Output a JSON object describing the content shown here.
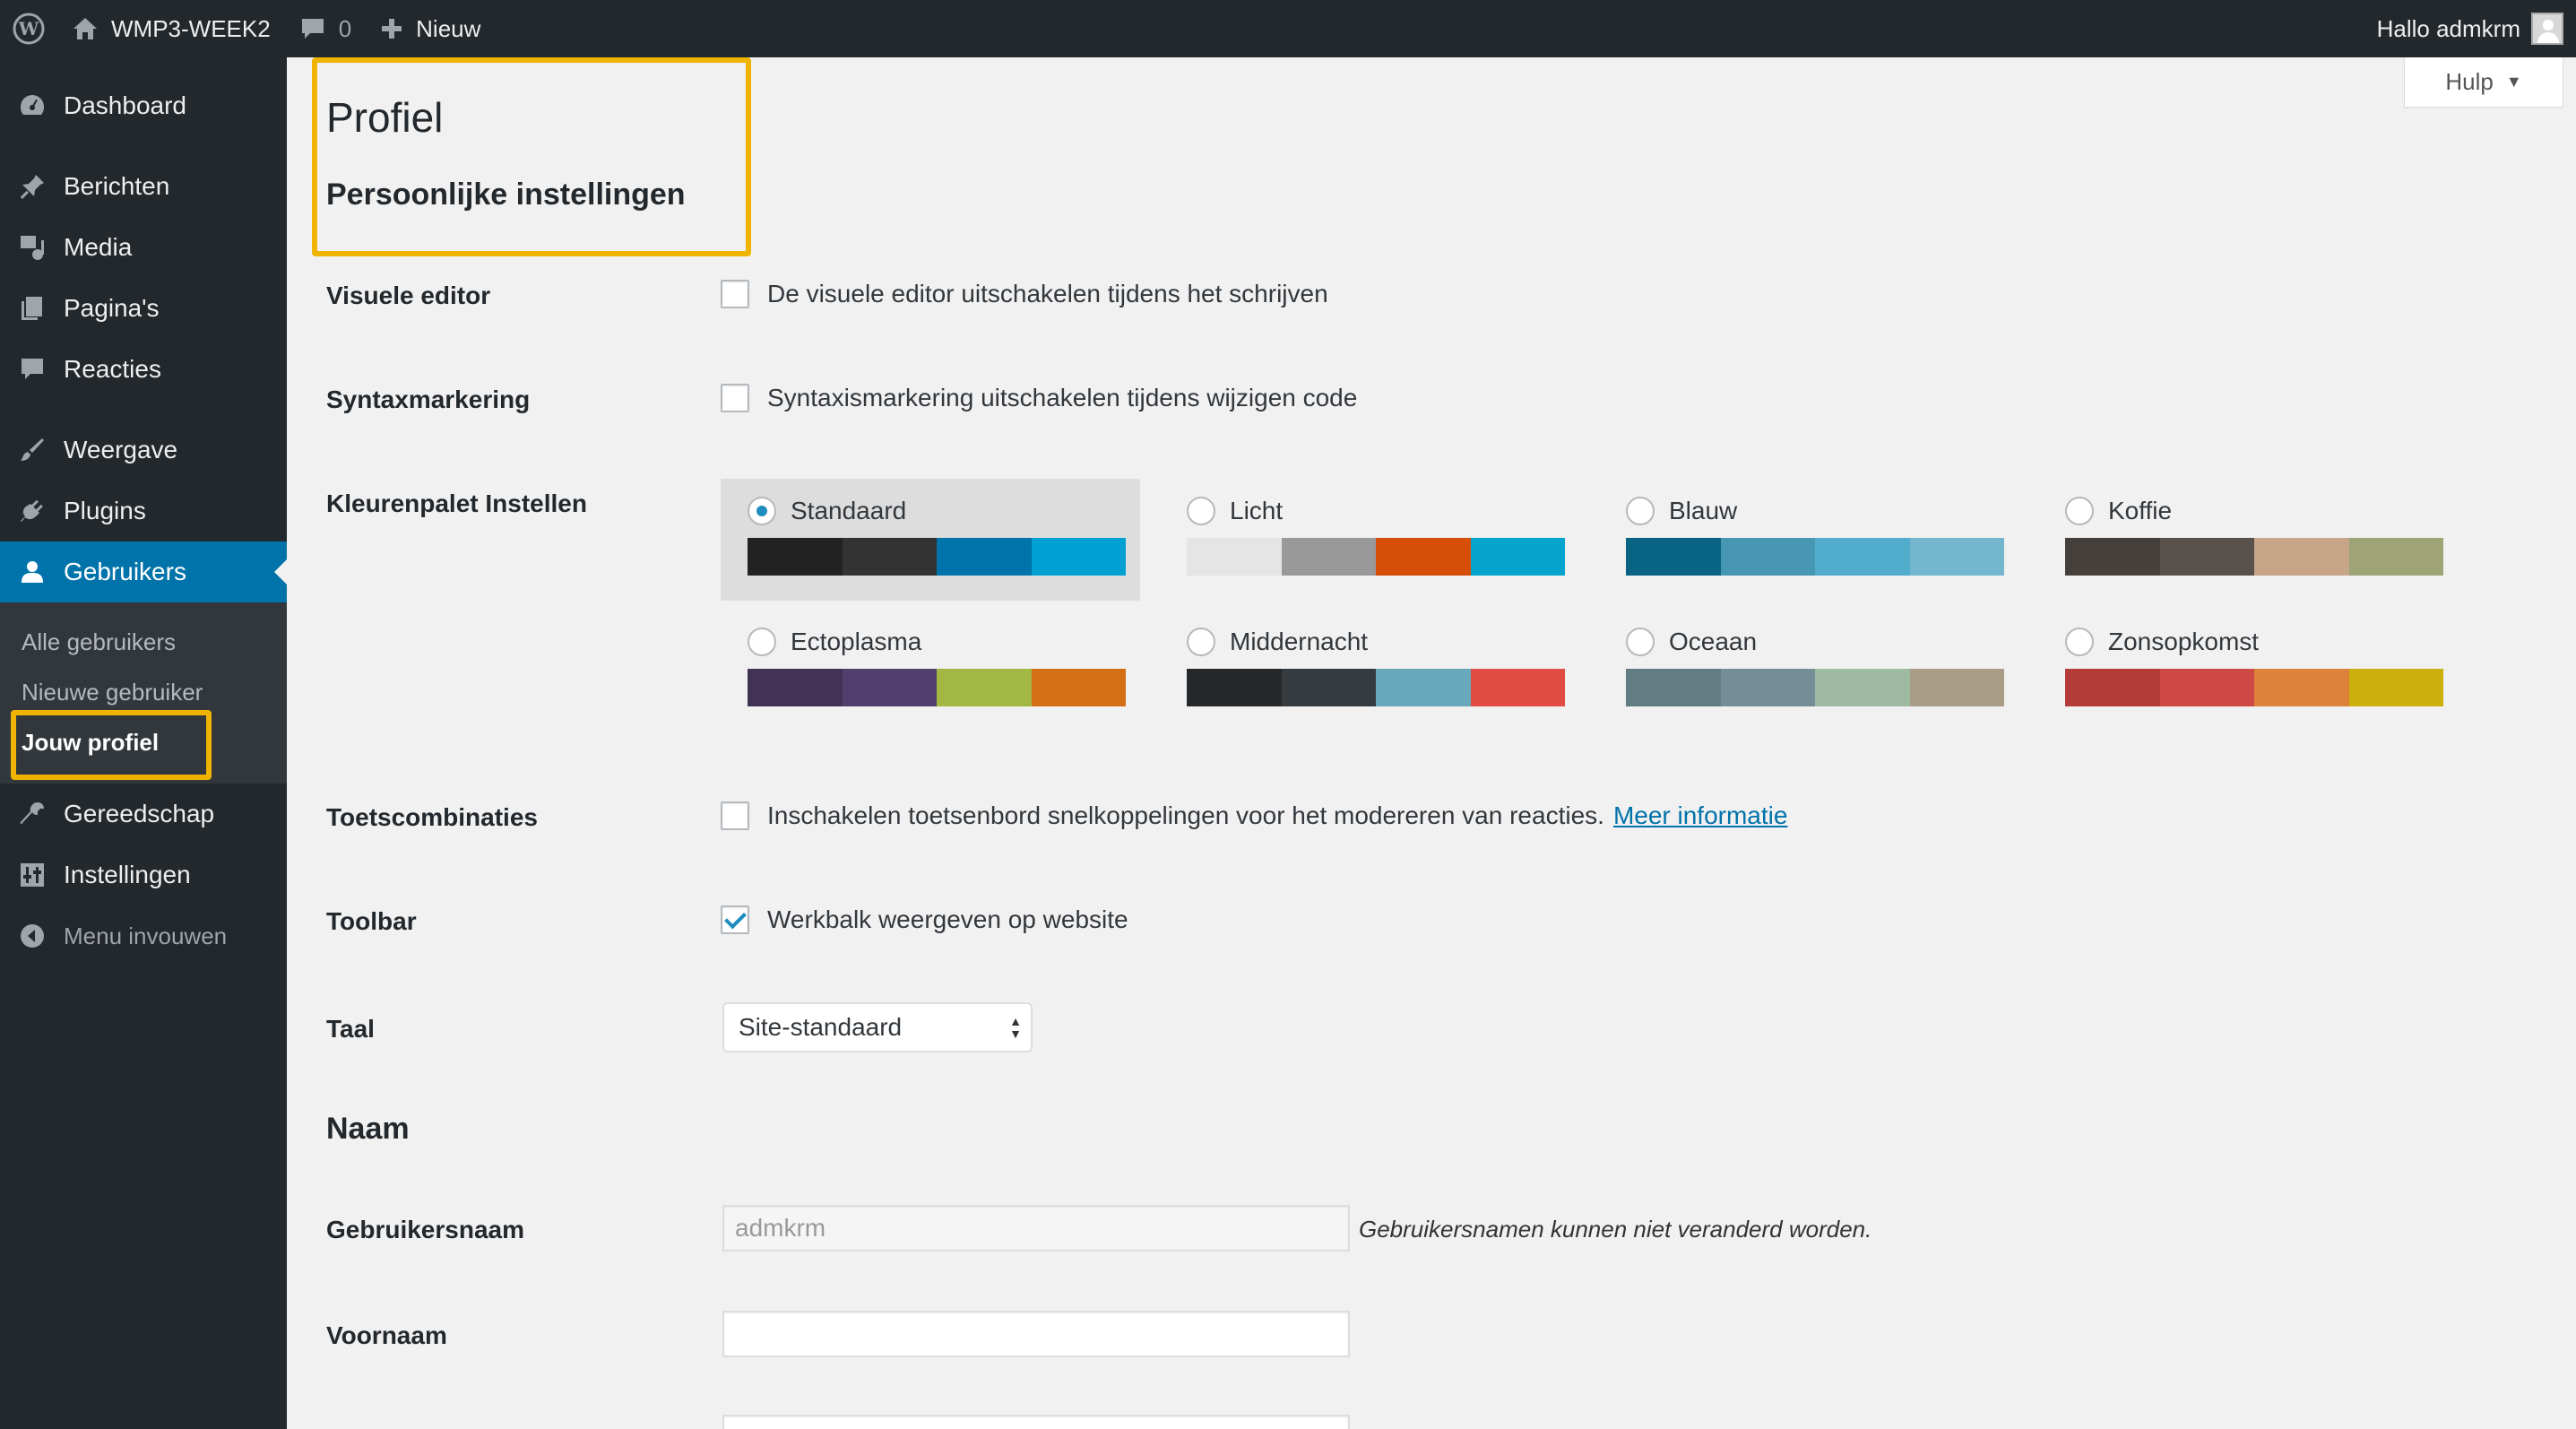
{
  "adminbar": {
    "site_name": "WMP3-WEEK2",
    "comments_count": "0",
    "new_label": "Nieuw",
    "greeting": "Hallo admkrm"
  },
  "sidebar": {
    "items": [
      {
        "label": "Dashboard",
        "icon": "dashboard-icon"
      },
      {
        "label": "Berichten",
        "icon": "pin-icon"
      },
      {
        "label": "Media",
        "icon": "media-icon"
      },
      {
        "label": "Pagina's",
        "icon": "pages-icon"
      },
      {
        "label": "Reacties",
        "icon": "comments-icon"
      },
      {
        "label": "Weergave",
        "icon": "brush-icon"
      },
      {
        "label": "Plugins",
        "icon": "plugin-icon"
      },
      {
        "label": "Gebruikers",
        "icon": "users-icon"
      },
      {
        "label": "Gereedschap",
        "icon": "wrench-icon"
      },
      {
        "label": "Instellingen",
        "icon": "settings-icon"
      }
    ],
    "submenu": [
      "Alle gebruikers",
      "Nieuwe gebruiker",
      "Jouw profiel"
    ],
    "collapse_label": "Menu invouwen"
  },
  "header": {
    "help_label": "Hulp",
    "page_title": "Profiel",
    "section_personal": "Persoonlijke instellingen"
  },
  "settings": {
    "visual_editor": {
      "label": "Visuele editor",
      "option": "De visuele editor uitschakelen tijdens het schrijven",
      "checked": false
    },
    "syntax": {
      "label": "Syntaxmarkering",
      "option": "Syntaxismarkering uitschakelen tijdens wijzigen code",
      "checked": false
    },
    "color_scheme_label": "Kleurenpalet Instellen",
    "color_schemes": [
      {
        "name": "Standaard",
        "selected": true,
        "colors": [
          "#222222",
          "#333333",
          "#0073aa",
          "#00a0d2"
        ]
      },
      {
        "name": "Licht",
        "selected": false,
        "colors": [
          "#e5e5e5",
          "#999999",
          "#d64e07",
          "#04a4cc"
        ]
      },
      {
        "name": "Blauw",
        "selected": false,
        "colors": [
          "#096484",
          "#4796b3",
          "#52accc",
          "#74b6ce"
        ]
      },
      {
        "name": "Koffie",
        "selected": false,
        "colors": [
          "#46403c",
          "#59524c",
          "#c7a589",
          "#9ea476"
        ]
      },
      {
        "name": "Ectoplasma",
        "selected": false,
        "colors": [
          "#413256",
          "#523f6d",
          "#a3b745",
          "#d46f15"
        ]
      },
      {
        "name": "Middernacht",
        "selected": false,
        "colors": [
          "#25282b",
          "#363b3f",
          "#69a8bb",
          "#e14d43"
        ]
      },
      {
        "name": "Oceaan",
        "selected": false,
        "colors": [
          "#627c83",
          "#738e96",
          "#9ebaa0",
          "#aa9d88"
        ]
      },
      {
        "name": "Zonsopkomst",
        "selected": false,
        "colors": [
          "#b43c38",
          "#cf4944",
          "#dd823b",
          "#ccaf0b"
        ]
      }
    ],
    "shortcuts": {
      "label": "Toetscombinaties",
      "option": "Inschakelen toetsenbord snelkoppelingen voor het modereren van reacties.",
      "link": "Meer informatie",
      "checked": false
    },
    "toolbar": {
      "label": "Toolbar",
      "option": "Werkbalk weergeven op website",
      "checked": true
    },
    "language": {
      "label": "Taal",
      "value": "Site-standaard"
    }
  },
  "name_section": {
    "title": "Naam",
    "username": {
      "label": "Gebruikersnaam",
      "value": "admkrm",
      "description": "Gebruikersnamen kunnen niet veranderd worden."
    },
    "firstname": {
      "label": "Voornaam",
      "value": ""
    }
  },
  "colors": {
    "adminbar_bg": "#23282d",
    "active_menu": "#0073aa",
    "highlight": "#f0b400",
    "link": "#0073aa"
  }
}
